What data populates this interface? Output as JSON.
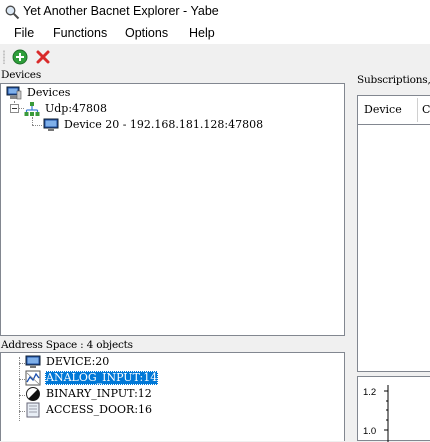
{
  "window": {
    "title": "Yet Another Bacnet Explorer - Yabe",
    "icon": "magnifier-icon"
  },
  "menu": {
    "items": [
      "File",
      "Functions",
      "Options",
      "Help"
    ]
  },
  "toolbar": {
    "buttons": [
      {
        "name": "add-device",
        "icon": "green-plus-circle-icon",
        "color": "#2e9e3a"
      },
      {
        "name": "remove-device",
        "icon": "red-x-icon",
        "color": "#d92b2b"
      }
    ]
  },
  "devices_panel": {
    "label": "Devices",
    "tree": {
      "root": "Devices",
      "transport": "Udp:47808",
      "device": "Device 20 - 192.168.181.128:47808"
    }
  },
  "address_space_panel": {
    "label": "Address Space : 4 objects",
    "items": [
      {
        "label": "DEVICE:20",
        "icon": "device-computer-icon",
        "selected": false
      },
      {
        "label": "ANALOG_INPUT:14",
        "icon": "analog-input-icon",
        "selected": true
      },
      {
        "label": "BINARY_INPUT:12",
        "icon": "binary-input-icon",
        "selected": false
      },
      {
        "label": "ACCESS_DOOR:16",
        "icon": "access-door-icon",
        "selected": false
      }
    ]
  },
  "subscriptions_panel": {
    "label": "Subscriptions, P",
    "columns": [
      "Device",
      "C"
    ]
  },
  "plot_panel": {
    "y_ticks": [
      "1.2",
      "1.0"
    ]
  },
  "colors": {
    "selection": "#0078d7",
    "pane_border": "#828790"
  }
}
